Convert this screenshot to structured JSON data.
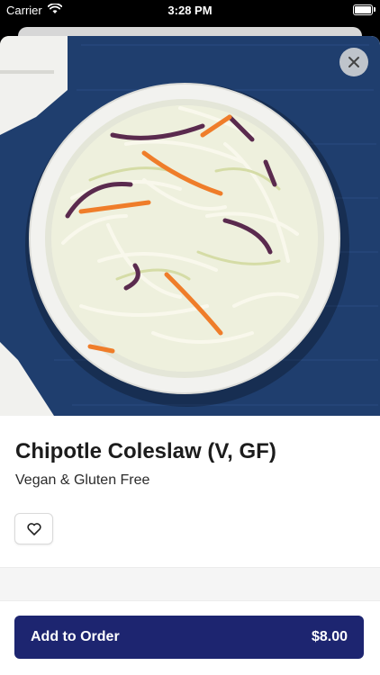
{
  "status_bar": {
    "carrier": "Carrier",
    "time": "3:28 PM"
  },
  "item": {
    "name": "Chipotle Coleslaw (V, GF)",
    "description": "Vegan & Gluten Free",
    "image_icon": "coleslaw-bowl-photo"
  },
  "actions": {
    "close_icon": "close-icon",
    "favorite_icon": "heart-icon",
    "add_label": "Add to Order",
    "price": "$8.00"
  },
  "colors": {
    "accent": "#1d2570",
    "napkin": "#1f3e6e",
    "table": "#f1f1ee"
  }
}
